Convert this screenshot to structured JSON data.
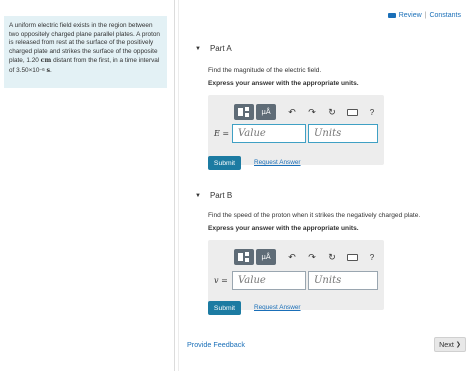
{
  "header": {
    "review_label": "Review",
    "separator": "|",
    "constants_label": "Constants"
  },
  "problem": {
    "text_before_distance": "A uniform electric field exists in the region between two oppositely charged plane parallel plates. A proton is released from rest at the surface of the positively charged plate and strikes the surface of the opposite plate, 1.20",
    "distance_unit": "cm",
    "text_before_time": "distant from the first, in a time interval of",
    "time_mantissa": "3.50×10",
    "time_exponent": "−6",
    "time_unit": "s",
    "end": "."
  },
  "parts": [
    {
      "title": "Part A",
      "question": "Find the magnitude of the electric field.",
      "instruction": "Express your answer with the appropriate units.",
      "variable": "E =",
      "value_placeholder": "Value",
      "units_placeholder": "Units",
      "submit_label": "Submit",
      "request_label": "Request Answer"
    },
    {
      "title": "Part B",
      "question": "Find the speed of the proton when it strikes the negatively charged plate.",
      "instruction": "Express your answer with the appropriate units.",
      "variable": "v =",
      "value_placeholder": "Value",
      "units_placeholder": "Units",
      "submit_label": "Submit",
      "request_label": "Request Answer"
    }
  ],
  "toolbar": {
    "mu_label": "μÅ",
    "undo_glyph": "↶",
    "redo_glyph": "↷",
    "reset_glyph": "↻",
    "help_glyph": "?"
  },
  "footer": {
    "feedback_label": "Provide Feedback",
    "next_label": "Next",
    "next_glyph": "❯"
  },
  "colors": {
    "accent": "#1c7ba2",
    "link": "#1a6fb8",
    "problem_bg": "#e3f1f5",
    "toolbar_btn": "#5f6c77"
  }
}
